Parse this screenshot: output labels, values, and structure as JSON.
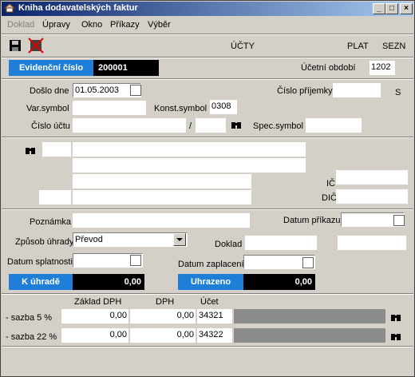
{
  "window": {
    "title": "Kniha dodavatelských faktur"
  },
  "menu": {
    "doklad": "Doklad",
    "upravy": "Úpravy",
    "okno": "Okno",
    "prikazy": "Příkazy",
    "vyber": "Výběr"
  },
  "toolbar": {
    "ucty": "ÚČTY",
    "plat": "PLAT",
    "sezn": "SEZN"
  },
  "header": {
    "evidencni_label": "Evidenční číslo",
    "evidencni_value": "200001",
    "obdobi_label": "Účetní období",
    "obdobi_value": "1202"
  },
  "doc": {
    "doslo_label": "Došlo dne",
    "doslo_value": "01.05.2003",
    "cislo_prijemky_label": "Číslo příjemky",
    "s_label": "S",
    "var_symbol_label": "Var.symbol",
    "konst_label": "Konst.symbol",
    "konst_value": "0308",
    "cislo_uctu_label": "Číslo účtu",
    "slash": "/",
    "spec_label": "Spec.symbol"
  },
  "partner": {
    "ic_label": "IČ",
    "dic_label": "DIČ"
  },
  "payment": {
    "poznamka_label": "Poznámka",
    "datum_prikazu_label": "Datum příkazu",
    "zpusob_label": "Způsob úhrady",
    "zpusob_value": "Převod",
    "doklad_label": "Doklad",
    "splatnost_label": "Datum splatnosti",
    "zaplaceni_label": "Datum zaplacení",
    "k_uhrade_label": "K úhradě",
    "k_uhrade_value": "0,00",
    "uhrazeno_label": "Uhrazeno",
    "uhrazeno_value": "0,00"
  },
  "vat": {
    "headers": {
      "zaklad": "Základ DPH",
      "dph": "DPH",
      "ucet": "Účet"
    },
    "rows": [
      {
        "label": "- sazba 5 %",
        "zaklad": "0,00",
        "dph": "0,00",
        "ucet": "34321"
      },
      {
        "label": "- sazba 22 %",
        "zaklad": "0,00",
        "dph": "0,00",
        "ucet": "34322"
      }
    ]
  }
}
